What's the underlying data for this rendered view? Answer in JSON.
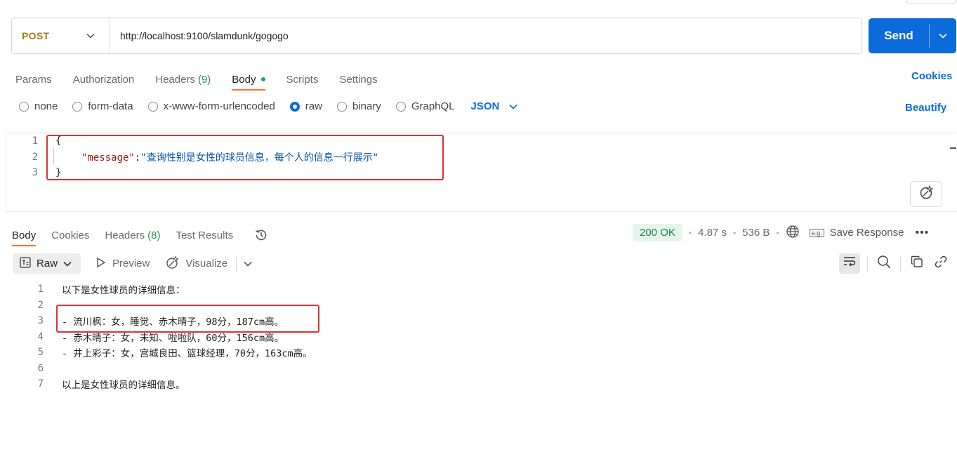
{
  "request": {
    "method": "POST",
    "url": "http://localhost:9100/slamdunk/gogogo",
    "send_label": "Send"
  },
  "request_tabs": [
    {
      "label": "Params"
    },
    {
      "label": "Authorization"
    },
    {
      "label": "Headers",
      "count": "(9)"
    },
    {
      "label": "Body"
    },
    {
      "label": "Scripts"
    },
    {
      "label": "Settings"
    }
  ],
  "cookies_label": "Cookies",
  "body_types": [
    "none",
    "form-data",
    "x-www-form-urlencoded",
    "raw",
    "binary",
    "GraphQL"
  ],
  "body_type_selected": "raw",
  "format_select": "JSON",
  "beautify_label": "Beautify",
  "editor": {
    "line_numbers": [
      "1",
      "2",
      "3"
    ],
    "open_brace": "{",
    "key": "\"message\"",
    "colon": ":",
    "value": "\"查询性别是女性的球员信息，每个人的信息一行展示\"",
    "close_brace": "}"
  },
  "response_tabs": [
    {
      "label": "Body"
    },
    {
      "label": "Cookies"
    },
    {
      "label": "Headers",
      "count": "(8)"
    },
    {
      "label": "Test Results"
    }
  ],
  "response_meta": {
    "status": "200 OK",
    "time": "4.87 s",
    "size": "536 B",
    "save_label": "Save Response",
    "eg_label": "e.g."
  },
  "response_toolbar": {
    "raw": "Raw",
    "preview": "Preview",
    "visualize": "Visualize"
  },
  "response_body": [
    {
      "n": "1",
      "text": "以下是女性球员的详细信息："
    },
    {
      "n": "2",
      "text": ""
    },
    {
      "n": "3",
      "text": "- 流川枫：女，睡觉、赤木晴子，98分，187cm高。"
    },
    {
      "n": "4",
      "text": "- 赤木晴子：女，未知、啦啦队，60分，156cm高。"
    },
    {
      "n": "5",
      "text": "- 井上彩子：女，宫城良田、篮球经理，70分，163cm高。"
    },
    {
      "n": "6",
      "text": ""
    },
    {
      "n": "7",
      "text": "以上是女性球员的详细信息。"
    }
  ],
  "colors": {
    "accent_blue": "#0b6bdb",
    "method_color": "#a07b16",
    "active_tab_underline": "#ff6c37",
    "status_green": "#1e7e46",
    "highlight_red": "#e03131"
  }
}
